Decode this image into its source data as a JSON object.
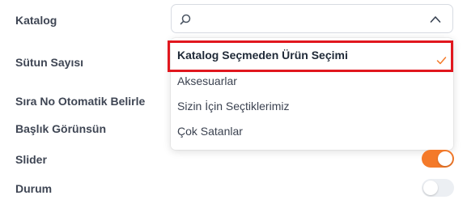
{
  "form": {
    "labels": {
      "katalog": "Katalog",
      "sutun_sayisi": "Sütun Sayısı",
      "sira_no": "Sıra No Otomatik Belirle",
      "baslik": "Başlık Görünsün",
      "slider": "Slider",
      "durum": "Durum"
    },
    "katalog_select": {
      "search_value": "",
      "search_icon": "search-icon",
      "chevron_icon": "chevron-up-icon",
      "options": [
        {
          "label": "Katalog Seçmeden Ürün Seçimi",
          "selected": true
        },
        {
          "label": "Aksesuarlar",
          "selected": false
        },
        {
          "label": "Sizin İçin Seçtiklerimiz",
          "selected": false
        },
        {
          "label": "Çok Satanlar",
          "selected": false
        }
      ]
    },
    "toggles": {
      "slider": {
        "on": true,
        "color": "#f47a2a"
      },
      "durum": {
        "on": false,
        "color": "#eceff3"
      }
    },
    "highlight_color": "#e1171e"
  }
}
